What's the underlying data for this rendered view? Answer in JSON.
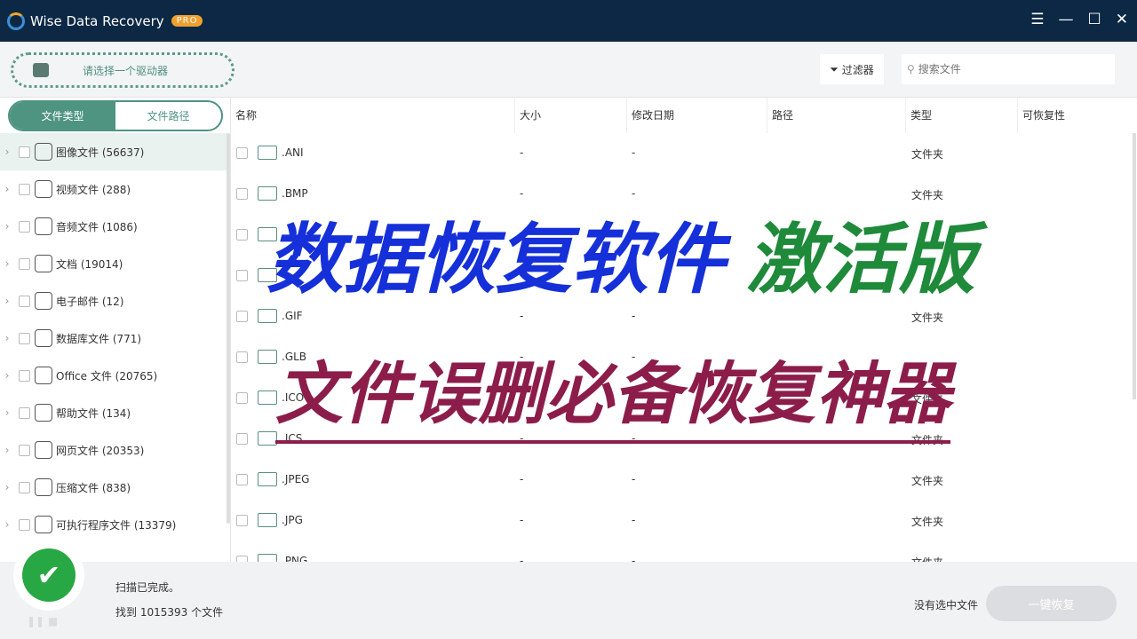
{
  "app": {
    "title": "Wise Data Recovery",
    "badge": "PRO",
    "icons": [
      "menu-icon",
      "minimize-icon",
      "maximize-icon",
      "close-icon"
    ]
  },
  "toolbar": {
    "drive_label": "请选择一个驱动器",
    "filter_label": "过滤器",
    "search_placeholder": "搜索文件"
  },
  "left": {
    "tabs": [
      "文件类型",
      "文件路径"
    ],
    "categories": [
      {
        "label": "图像文件 (56637)",
        "icon": "image-icon"
      },
      {
        "label": "视频文件 (288)",
        "icon": "video-icon"
      },
      {
        "label": "音频文件 (1086)",
        "icon": "audio-icon"
      },
      {
        "label": "文档 (19014)",
        "icon": "document-icon"
      },
      {
        "label": "电子邮件 (12)",
        "icon": "email-icon"
      },
      {
        "label": "数据库文件 (771)",
        "icon": "database-icon"
      },
      {
        "label": "Office 文件 (20765)",
        "icon": "office-icon"
      },
      {
        "label": "帮助文件 (134)",
        "icon": "help-icon"
      },
      {
        "label": "网页文件 (20353)",
        "icon": "web-icon"
      },
      {
        "label": "压缩文件 (838)",
        "icon": "zip-icon"
      },
      {
        "label": "可执行程序文件 (13379)",
        "icon": "exe-icon"
      }
    ]
  },
  "table": {
    "columns": [
      "名称",
      "大小",
      "修改日期",
      "路径",
      "类型",
      "可恢复性"
    ],
    "rows": [
      {
        "name": ".ANI",
        "size": "-",
        "date": "-",
        "type": "文件夹"
      },
      {
        "name": ".BMP",
        "size": "-",
        "date": "-",
        "type": "文件夹"
      },
      {
        "name": "",
        "size": "",
        "date": "",
        "type": ""
      },
      {
        "name": "",
        "size": "",
        "date": "",
        "type": ""
      },
      {
        "name": ".GIF",
        "size": "-",
        "date": "-",
        "type": "文件夹"
      },
      {
        "name": ".GLB",
        "size": "-",
        "date": "-",
        "type": ""
      },
      {
        "name": ".ICO",
        "size": "-",
        "date": "-",
        "type": "文件夹"
      },
      {
        "name": ".ICS",
        "size": "-",
        "date": "-",
        "type": "文件夹"
      },
      {
        "name": ".JPEG",
        "size": "-",
        "date": "-",
        "type": "文件夹"
      },
      {
        "name": ".JPG",
        "size": "-",
        "date": "-",
        "type": "文件夹"
      },
      {
        "name": ".PNG",
        "size": "-",
        "date": "-",
        "type": "文件夹"
      }
    ]
  },
  "status": {
    "line1": "扫描已完成。",
    "line2": "找到 1015393 个文件",
    "selection": "没有选中文件",
    "recover_label": "一键恢复"
  },
  "overlay": {
    "line1a": "数据恢复软件",
    "line1b": "激活版",
    "line2": "文件误删必备恢复神器",
    "colors": {
      "blue": "#1530d8",
      "green": "#1e8a3a",
      "maroon": "#8c1d4a"
    }
  }
}
